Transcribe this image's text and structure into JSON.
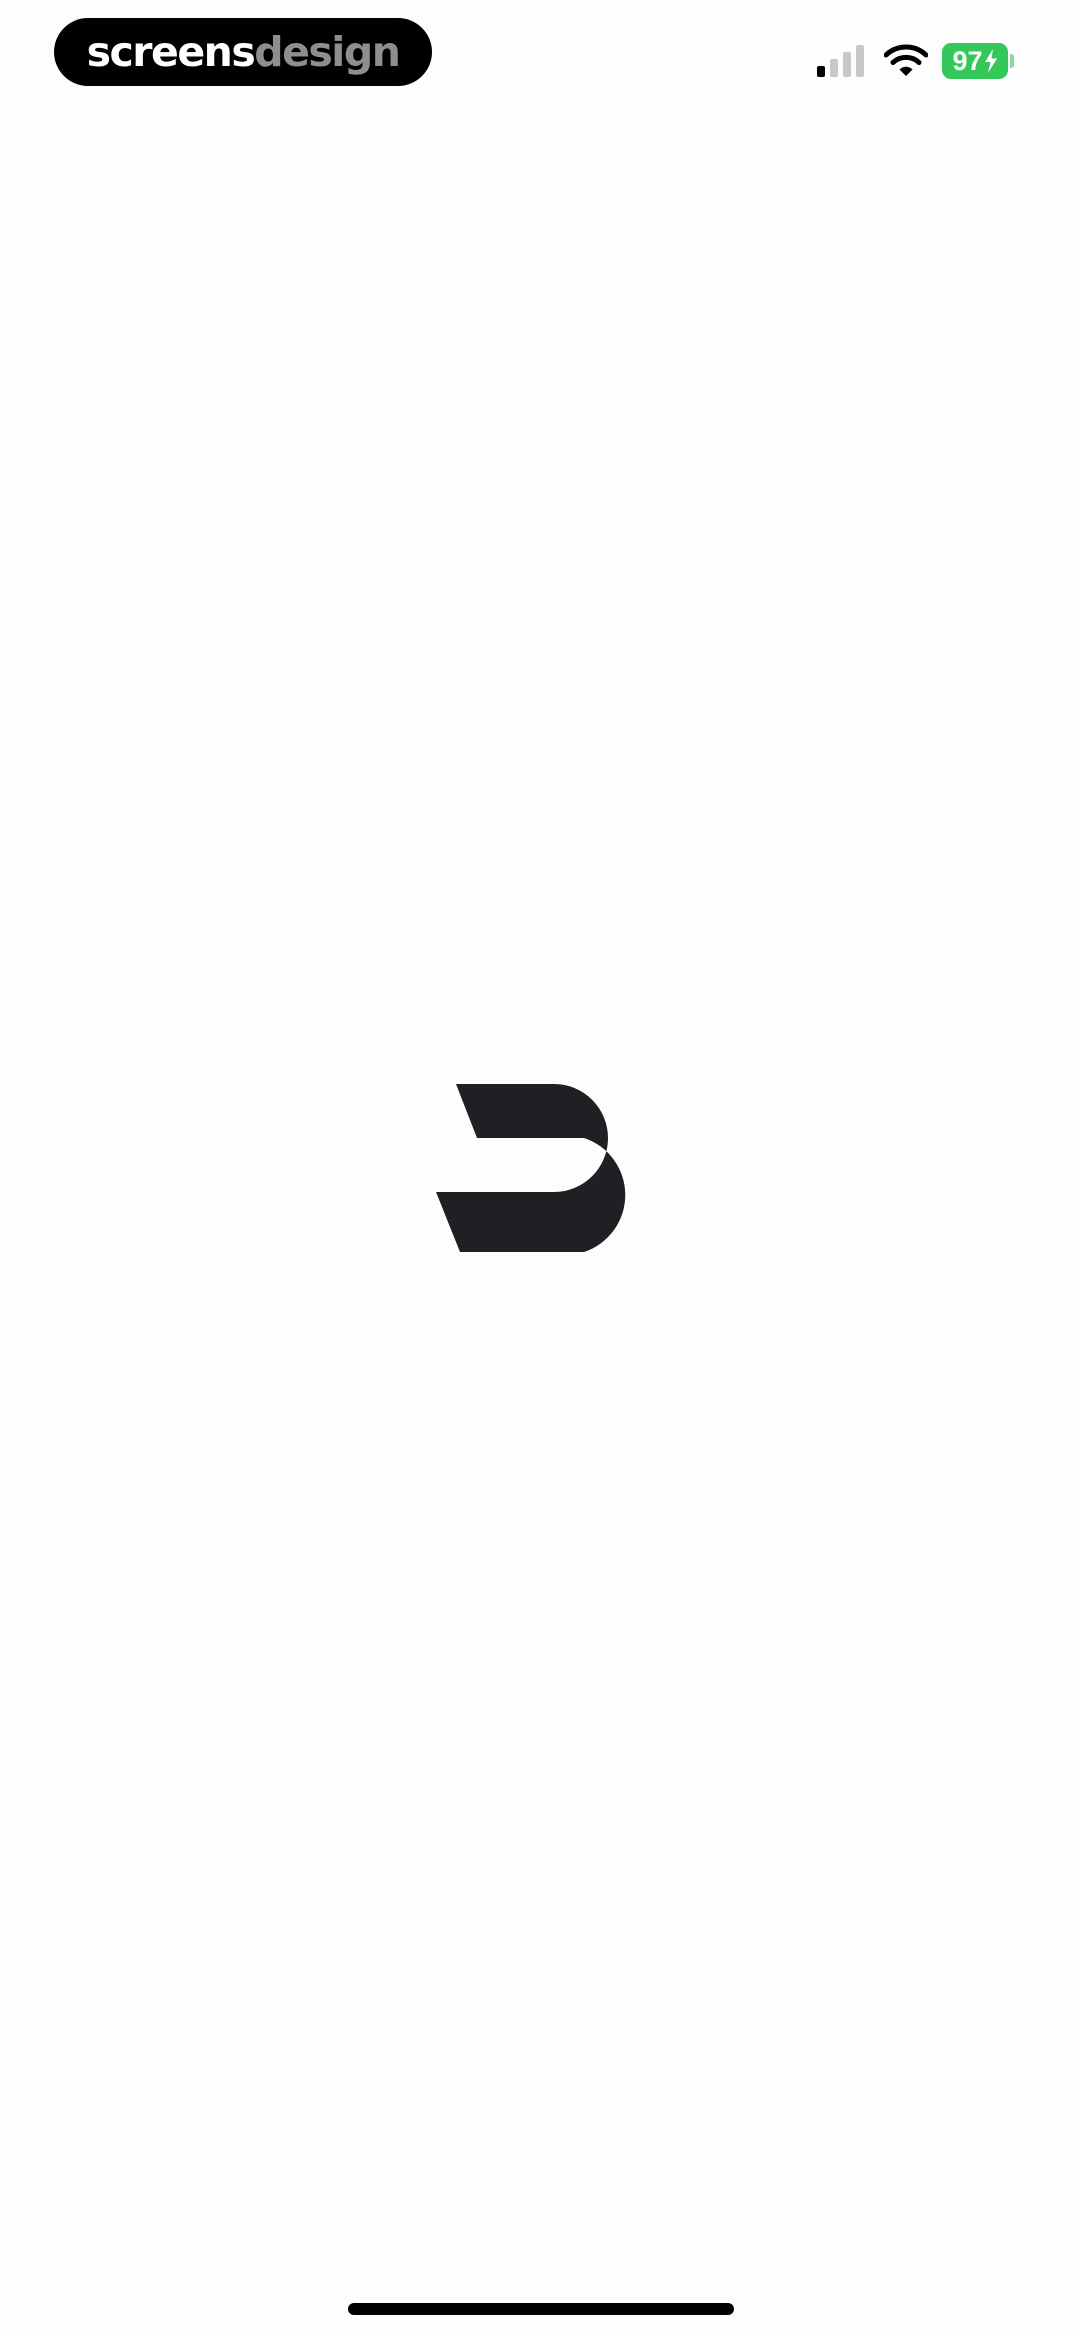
{
  "status_bar": {
    "brand": {
      "part_a": "screens",
      "part_b": "design"
    },
    "signal_icon": "cellular-signal-icon",
    "signal_level": 0.25,
    "wifi_icon": "wifi-icon",
    "battery_percent": "97",
    "battery_charging": true,
    "battery_color": "#34c759"
  },
  "splash": {
    "logo_icon": "app-logo-b-icon",
    "logo_color": "#202024",
    "background_color": "#fdfdfd"
  },
  "home_indicator": {
    "icon": "home-indicator-bar"
  }
}
